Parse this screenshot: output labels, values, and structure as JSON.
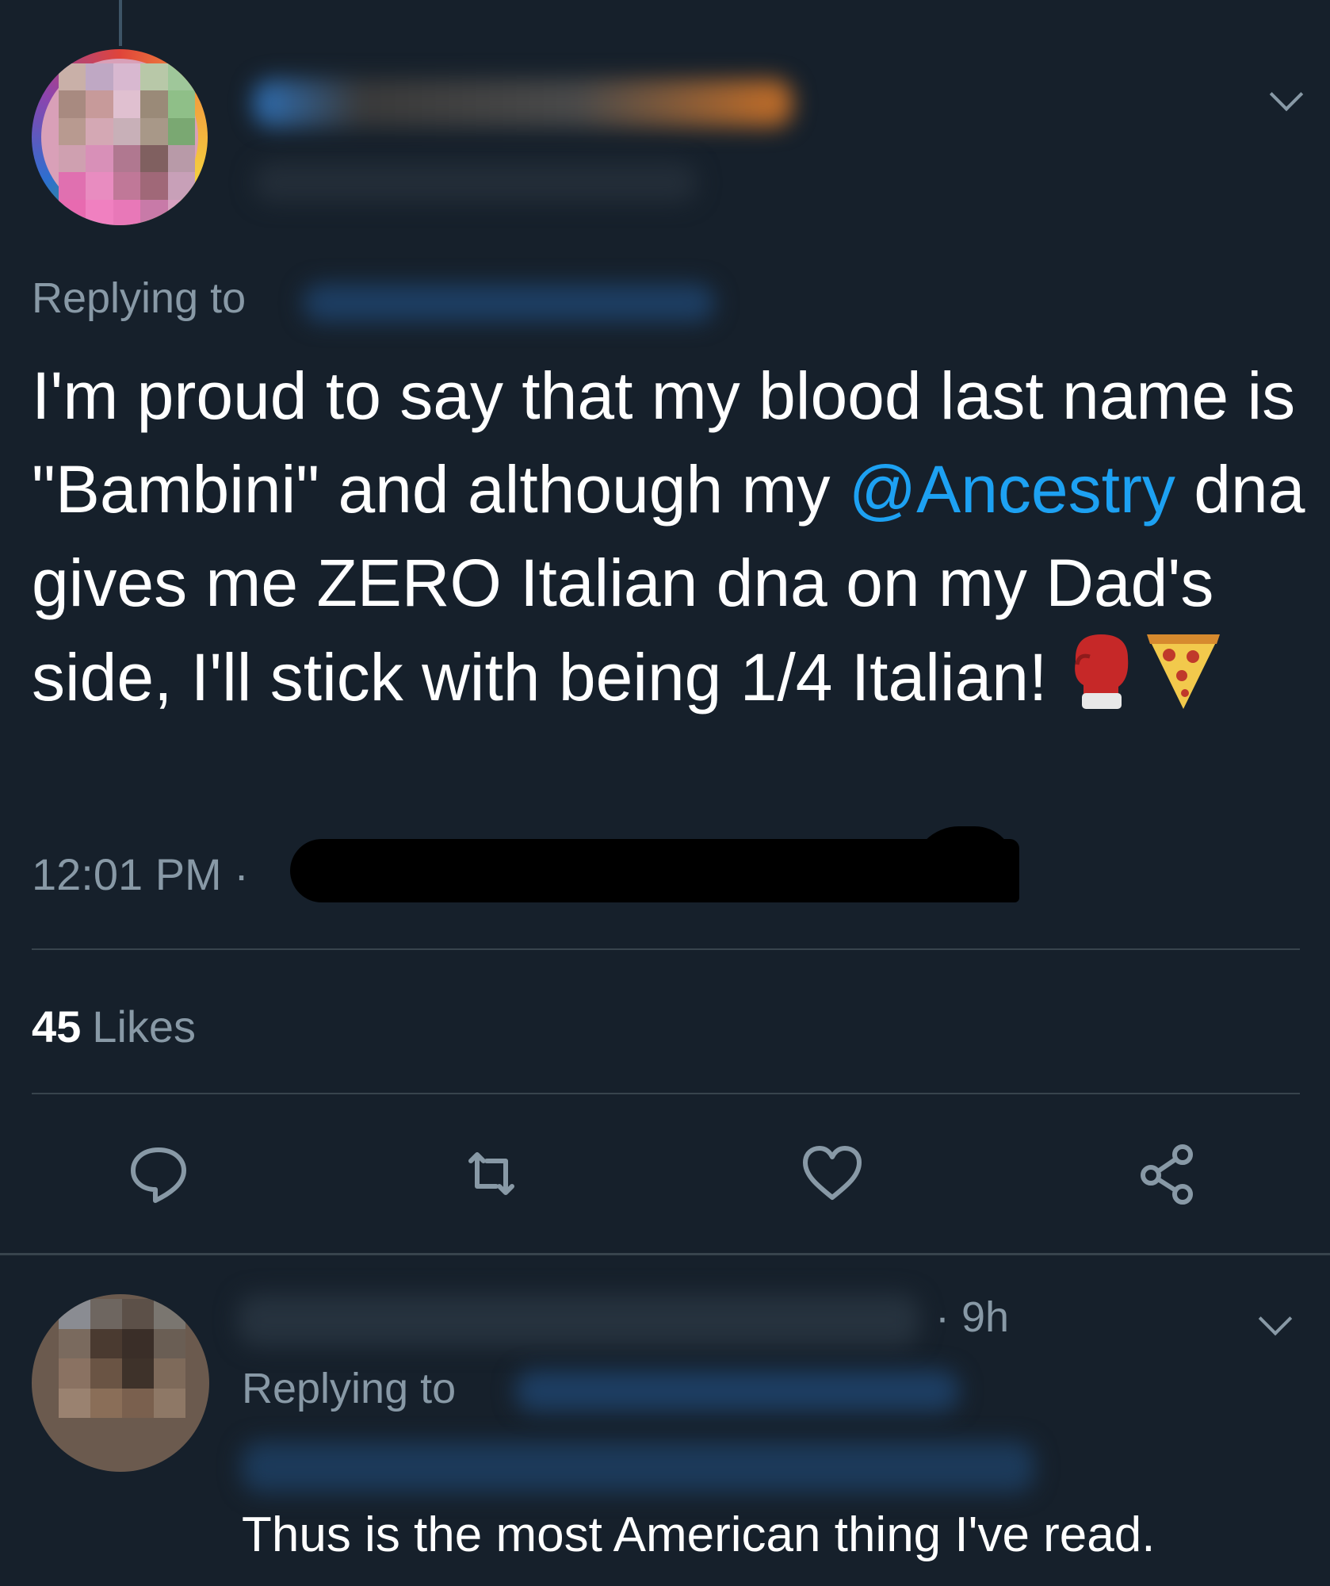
{
  "tweet": {
    "replying_label": "Replying to",
    "text_before_mention": "I'm proud to say that my blood last name is \"Bambini\" and although my ",
    "mention": "@Ancestry",
    "text_after_mention": " dna gives me ZERO Italian dna on my Dad's side, I'll stick with being 1/4 Italian! ",
    "emojis": [
      "boxing-glove-emoji",
      "pizza-emoji"
    ],
    "time": "12:01 PM",
    "time_separator": "·",
    "likes_count": "45",
    "likes_label": "Likes"
  },
  "actions": [
    {
      "name": "reply",
      "icon": "comment-icon"
    },
    {
      "name": "retweet",
      "icon": "retweet-icon"
    },
    {
      "name": "like",
      "icon": "heart-icon"
    },
    {
      "name": "share",
      "icon": "share-icon"
    }
  ],
  "reply_tweet": {
    "time": "· 9h",
    "replying_label": "Replying to",
    "text": "Thus is the most American thing I've read."
  },
  "colors": {
    "background": "#16202b",
    "text": "#ffffff",
    "secondary": "#8899a6",
    "accent": "#1da1f2",
    "divider": "#38444d"
  }
}
